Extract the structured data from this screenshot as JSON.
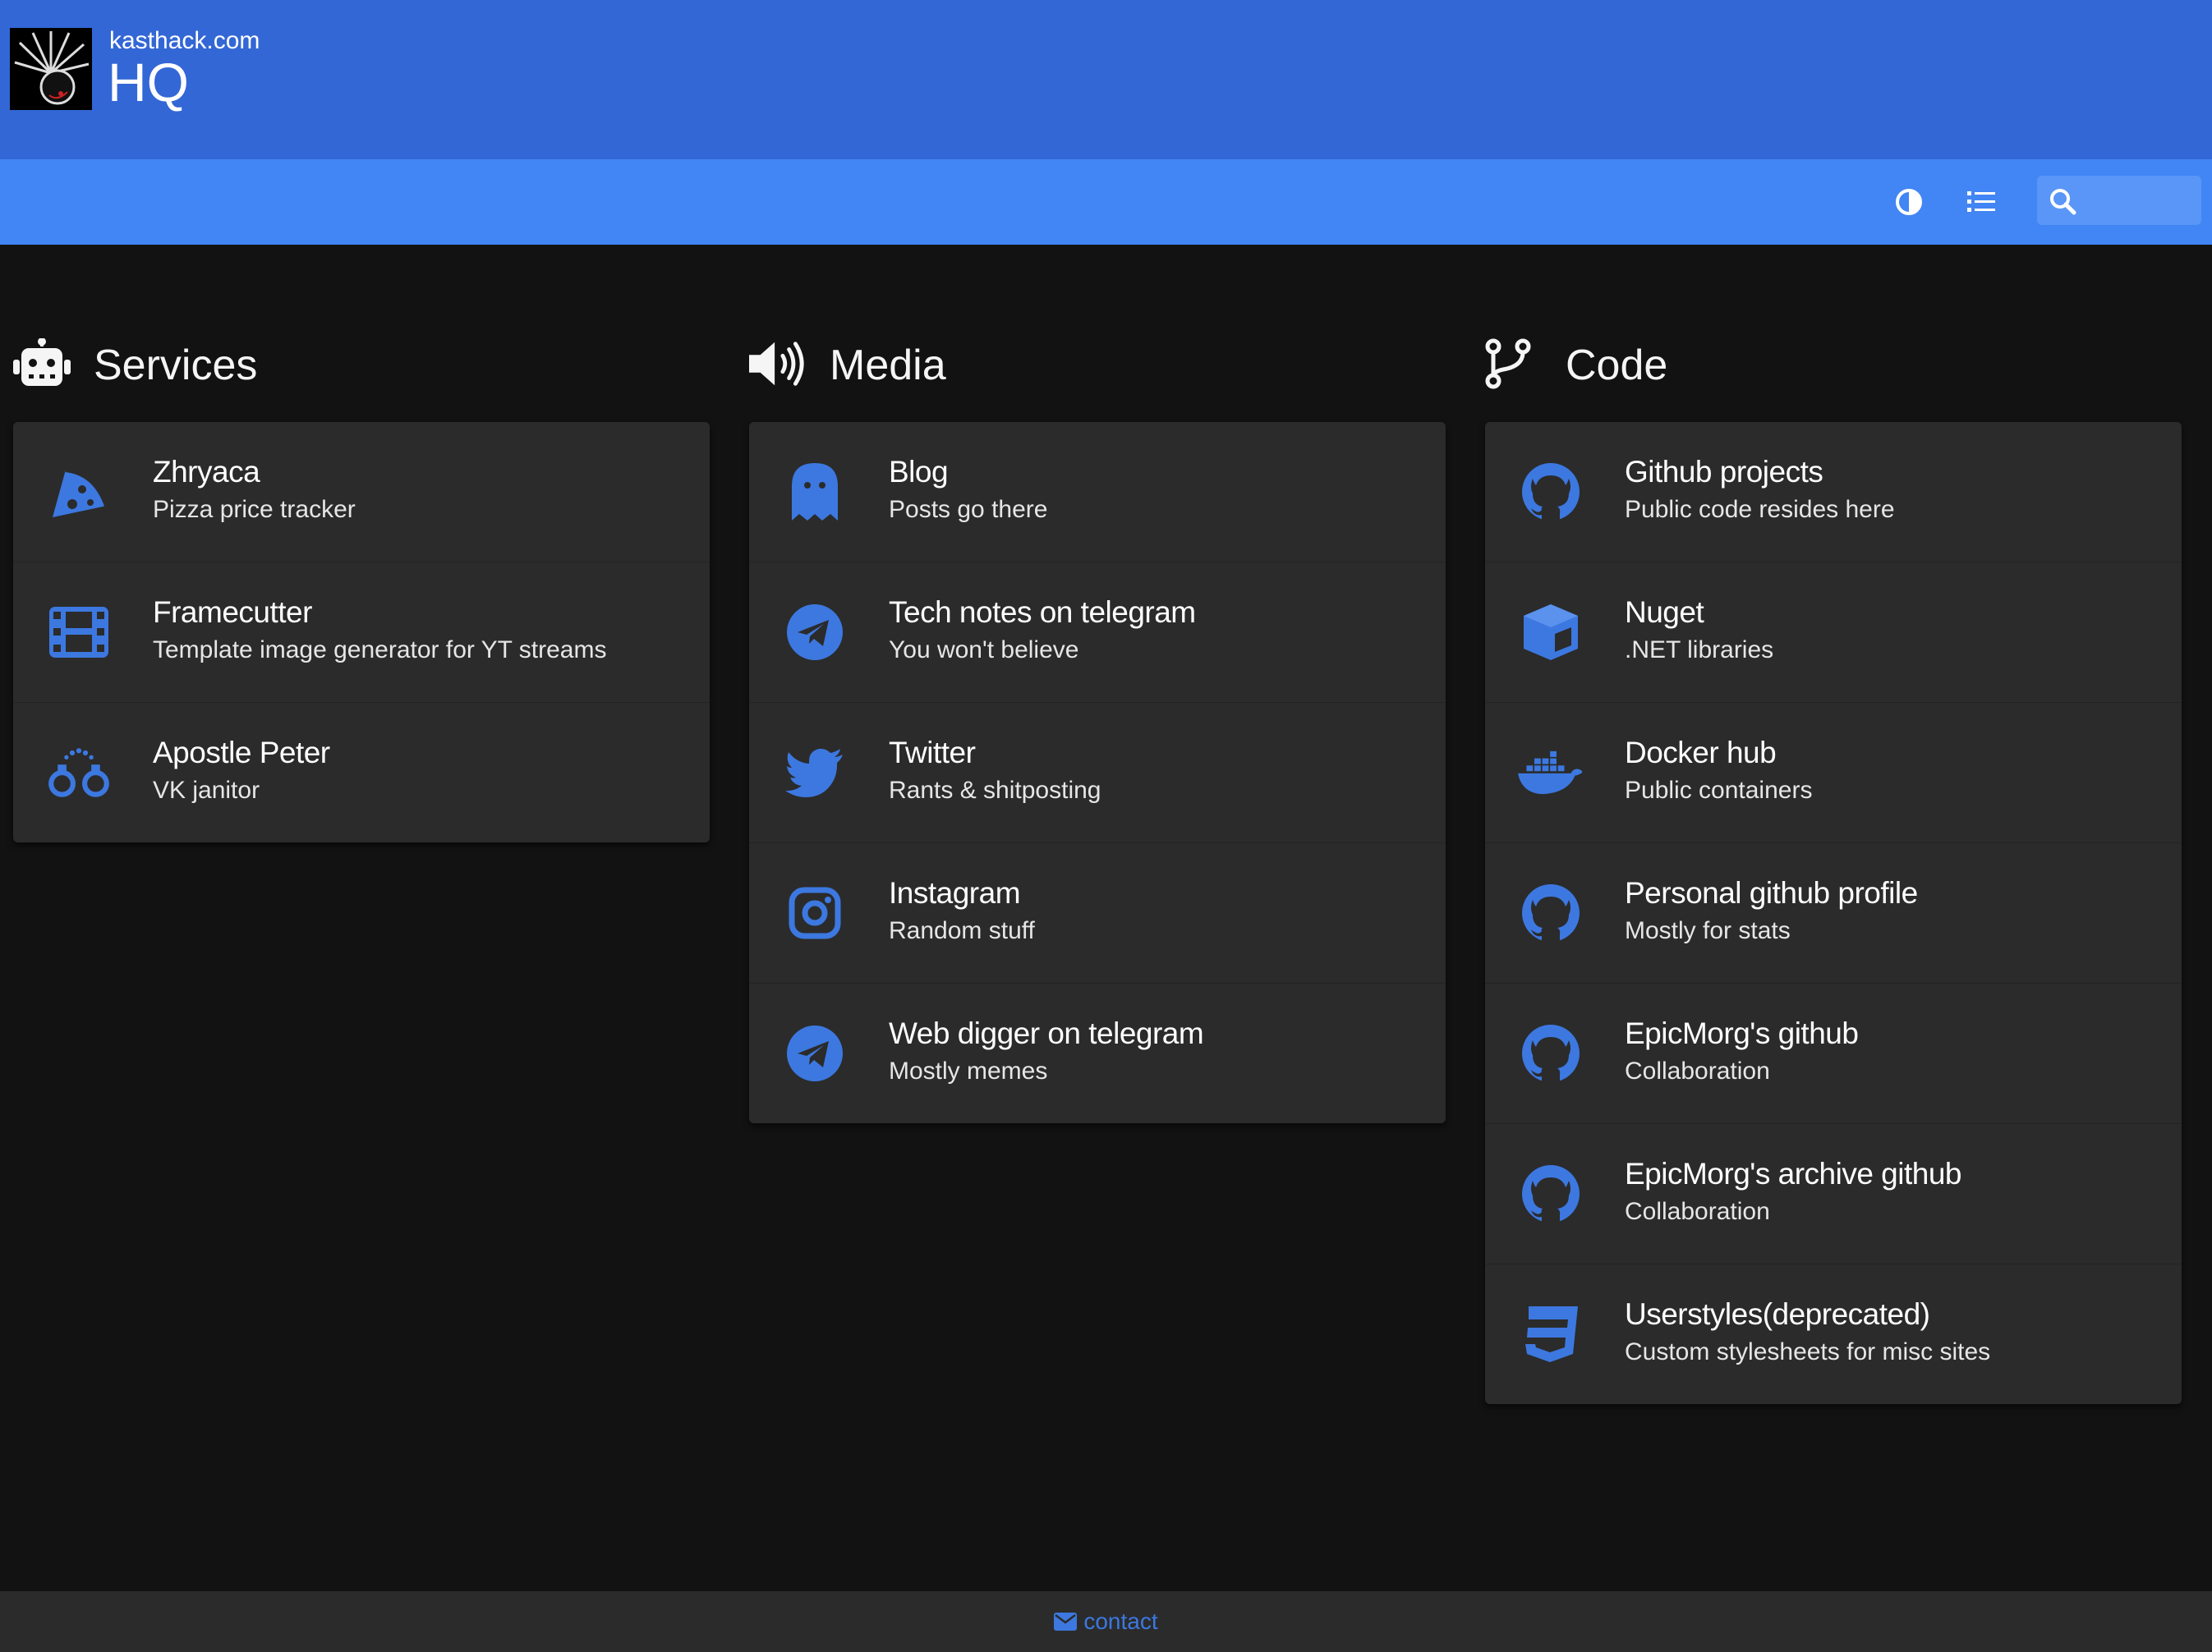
{
  "header": {
    "headline": "kasthack.com",
    "title": "HQ"
  },
  "toolbar": {
    "theme_icon": "half-circle-contrast-icon",
    "layout_icon": "list-icon",
    "search_icon": "magnifier-icon",
    "search_value": ""
  },
  "colors": {
    "header": "#3367d6",
    "navbar": "#4285f4",
    "accent_icon": "#3c78e0",
    "background": "#121212",
    "card": "#2b2b2b",
    "footer": "#2b2b2b"
  },
  "groups": [
    {
      "name": "Services",
      "icon": "robot-icon",
      "items": [
        {
          "name": "Zhryaca",
          "subtitle": "Pizza price tracker",
          "icon": "pizza-icon"
        },
        {
          "name": "Framecutter",
          "subtitle": "Template image generator for YT streams",
          "icon": "film-icon"
        },
        {
          "name": "Apostle Peter",
          "subtitle": "VK janitor",
          "icon": "handcuffs-icon"
        }
      ]
    },
    {
      "name": "Media",
      "icon": "volume-icon",
      "items": [
        {
          "name": "Blog",
          "subtitle": "Posts go there",
          "icon": "ghost-icon"
        },
        {
          "name": "Tech notes on telegram",
          "subtitle": "You won't believe",
          "icon": "telegram-icon"
        },
        {
          "name": "Twitter",
          "subtitle": "Rants & shitposting",
          "icon": "twitter-icon"
        },
        {
          "name": "Instagram",
          "subtitle": "Random stuff",
          "icon": "instagram-icon"
        },
        {
          "name": "Web digger on telegram",
          "subtitle": "Mostly memes",
          "icon": "telegram-icon"
        }
      ]
    },
    {
      "name": "Code",
      "icon": "code-branch-icon",
      "items": [
        {
          "name": "Github projects",
          "subtitle": "Public code resides here",
          "icon": "github-icon"
        },
        {
          "name": "Nuget",
          "subtitle": ".NET libraries",
          "icon": "cube-icon"
        },
        {
          "name": "Docker hub",
          "subtitle": "Public containers",
          "icon": "docker-icon"
        },
        {
          "name": "Personal github profile",
          "subtitle": "Mostly for stats",
          "icon": "github-icon"
        },
        {
          "name": "EpicMorg's github",
          "subtitle": "Collaboration",
          "icon": "github-icon"
        },
        {
          "name": "EpicMorg's archive github",
          "subtitle": "Collaboration",
          "icon": "github-icon"
        },
        {
          "name": "Userstyles(deprecated)",
          "subtitle": "Custom stylesheets for misc sites",
          "icon": "css3-icon"
        }
      ]
    }
  ],
  "footer": {
    "contact_icon": "envelope-icon",
    "contact_label": "contact"
  }
}
